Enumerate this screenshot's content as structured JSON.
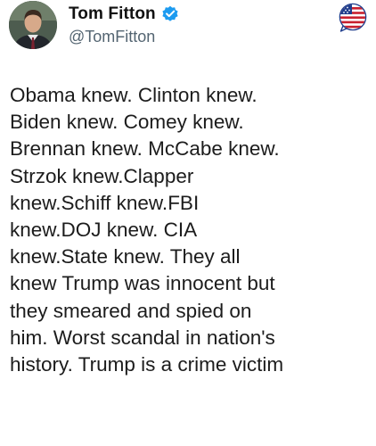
{
  "author": {
    "display_name": "Tom Fitton",
    "handle": "@TomFitton",
    "verified": true,
    "verified_icon": "verified-check-icon",
    "avatar_icon": "profile-avatar"
  },
  "corner_badge": {
    "icon": "us-flag-speech-bubble-icon"
  },
  "post": {
    "text": "Obama knew. Clinton knew.\nBiden knew. Comey knew.\nBrennan knew. McCabe knew.\nStrzok knew.Clapper\nknew.Schiff knew.FBI\nknew.DOJ knew. CIA\nknew.State knew. They all\nknew Trump was innocent but\nthey smeared and spied on\nhim. Worst scandal in nation's\nhistory. Trump is a crime victim"
  },
  "colors": {
    "verified_blue": "#1d9bf0",
    "handle_gray": "#536471",
    "text": "#1c1c1c",
    "badge_red": "#c8202f",
    "badge_blue": "#1f3d8c"
  }
}
